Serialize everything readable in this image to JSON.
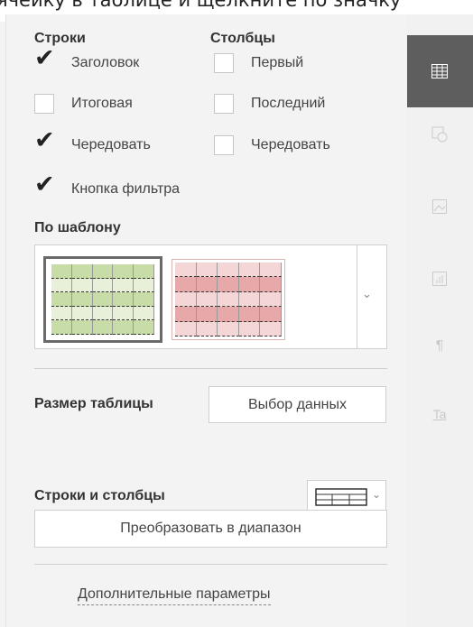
{
  "top_text": "ячейку в таблице и щелкните по значку",
  "rows": {
    "title": "Строки",
    "options": [
      {
        "label": "Заголовок",
        "checked": true
      },
      {
        "label": "Итоговая",
        "checked": false
      },
      {
        "label": "Чередовать",
        "checked": true
      },
      {
        "label": "Кнопка фильтра",
        "checked": true
      }
    ]
  },
  "columns": {
    "title": "Столбцы",
    "options": [
      {
        "label": "Первый",
        "checked": false
      },
      {
        "label": "Последний",
        "checked": false
      },
      {
        "label": "Чередовать",
        "checked": false
      }
    ]
  },
  "template": {
    "title": "По шаблону",
    "styles": [
      "green",
      "red"
    ],
    "selected": "green",
    "dropdown_icon": "chevron-down-icon"
  },
  "table_size": {
    "label": "Размер таблицы",
    "button": "Выбор данных"
  },
  "rows_cols": {
    "label": "Строки и столбцы",
    "icon": "table-grid-icon"
  },
  "convert_button": "Преобразовать в диапазон",
  "advanced_link": "Дополнительные параметры",
  "right_bar": {
    "icons": [
      "table-settings-icon",
      "shape-icon",
      "image-icon",
      "chart-icon",
      "paragraph-icon",
      "text-art-icon"
    ],
    "active": "table-settings-icon"
  },
  "colors": {
    "active_tab": "#5e5e5e",
    "panel_bg": "#f3f3f3",
    "template_green": "#c7dca7",
    "template_red": "#e6a8a8"
  }
}
